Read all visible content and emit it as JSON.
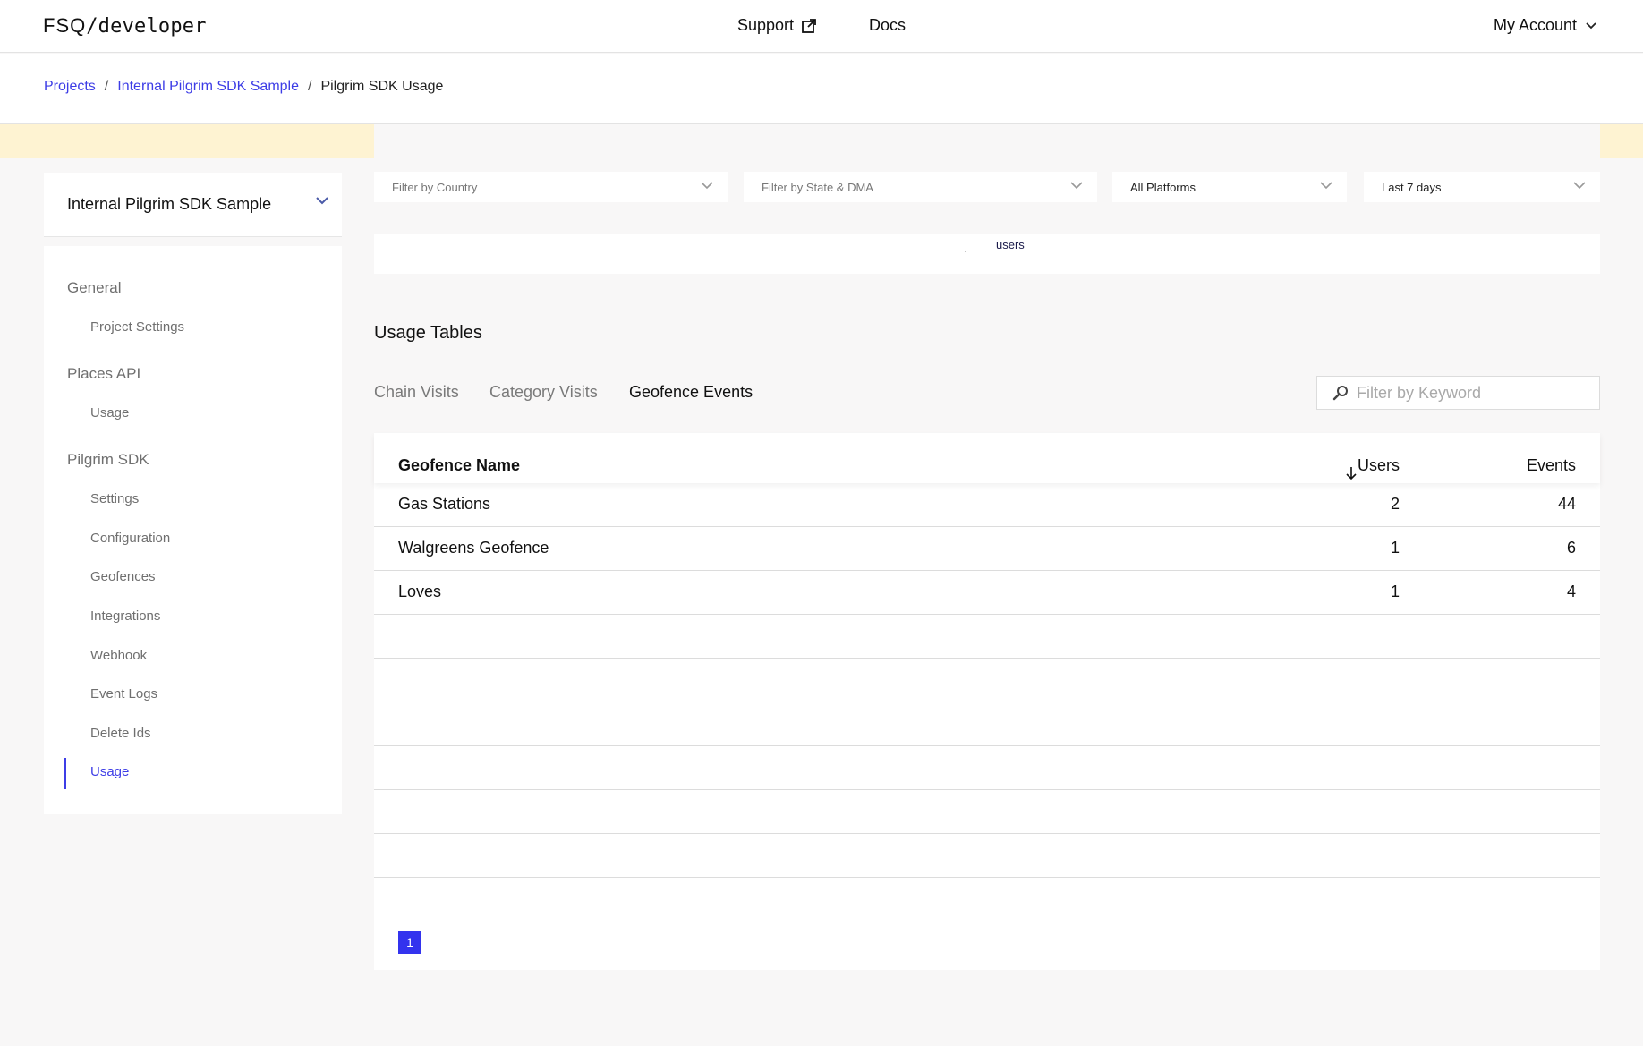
{
  "nav": {
    "logo_brand": "FSQ",
    "logo_suffix": "/developer",
    "support": "Support",
    "docs": "Docs",
    "account": "My Account"
  },
  "breadcrumb": {
    "items": [
      "Projects",
      "Internal Pilgrim SDK Sample"
    ],
    "current": "Pilgrim SDK Usage",
    "separator": "/"
  },
  "project_select": {
    "value": "Internal Pilgrim SDK Sample"
  },
  "sidebar": {
    "sections": [
      {
        "title": "General",
        "items": [
          "Project Settings"
        ]
      },
      {
        "title": "Places API",
        "items": [
          "Usage"
        ]
      },
      {
        "title": "Pilgrim SDK",
        "items": [
          "Settings",
          "Configuration",
          "Geofences",
          "Integrations",
          "Webhook",
          "Event Logs",
          "Delete Ids",
          "Usage"
        ]
      }
    ],
    "active_item": "Usage"
  },
  "filters": {
    "country": "Filter by Country",
    "state": "Filter by State & DMA",
    "platform": "All Platforms",
    "range": "Last 7 days"
  },
  "users_strip": {
    "dot": "·",
    "label": "users"
  },
  "usage": {
    "title": "Usage Tables",
    "tabs": [
      "Chain Visits",
      "Category Visits",
      "Geofence Events"
    ],
    "active_tab": "Geofence Events",
    "search_placeholder": "Filter by Keyword"
  },
  "table": {
    "columns": {
      "name": "Geofence Name",
      "users": "Users",
      "events": "Events"
    },
    "sort": {
      "column": "Users",
      "direction": "descending"
    },
    "rows": [
      {
        "name": "Gas Stations",
        "users": "2",
        "events": "44"
      },
      {
        "name": "Walgreens Geofence",
        "users": "1",
        "events": "6"
      },
      {
        "name": "Loves",
        "users": "1",
        "events": "4"
      }
    ],
    "empty_rows": 6
  },
  "pagination": {
    "current_page": "1"
  },
  "colors": {
    "accent": "#3d3de6",
    "banner": "#fef3d2",
    "page_button": "#3333ee"
  },
  "icons": [
    "external-link-icon",
    "chevron-down-icon",
    "search-icon",
    "sort-arrow-down-icon"
  ]
}
